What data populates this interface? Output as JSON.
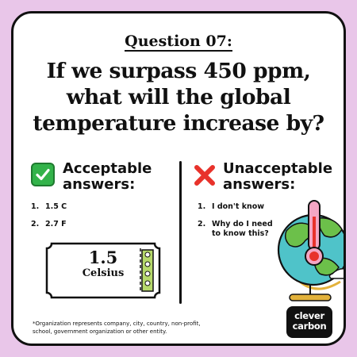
{
  "question": {
    "number_label": "Question 07:",
    "text_line1": "If we surpass 450 ppm,",
    "text_line2": "what will the global",
    "text_line3": "temperature increase by?"
  },
  "acceptable": {
    "heading_line1": "Acceptable",
    "heading_line2": "answers:",
    "icon": "check-mark-icon",
    "items": [
      {
        "num": "1.",
        "text": "1.5 C"
      },
      {
        "num": "2.",
        "text": "2.7 F"
      }
    ]
  },
  "unacceptable": {
    "heading_line1": "Unacceptable",
    "heading_line2": "answers:",
    "icon": "cross-mark-icon",
    "items": [
      {
        "num": "1.",
        "text": "I don't know"
      },
      {
        "num": "2.",
        "text_line1": "Why do I need",
        "text_line2": "to know this?"
      }
    ]
  },
  "ticket": {
    "value": "1.5",
    "unit": "Celsius"
  },
  "footnote": {
    "line1": "*Organization represents company, city, country, non-profit,",
    "line2": "school, government organization or other entity."
  },
  "logo": {
    "line1": "clever",
    "line2": "carbon"
  },
  "colors": {
    "background": "#e9c6e9",
    "card": "#ffffff",
    "check_green": "#33b34a",
    "cross_red": "#e8322b",
    "ticket_green": "#b6d96b",
    "globe_blue": "#4fc3c9",
    "globe_land": "#6cc04a",
    "thermometer_pink": "#f4a6c4"
  }
}
